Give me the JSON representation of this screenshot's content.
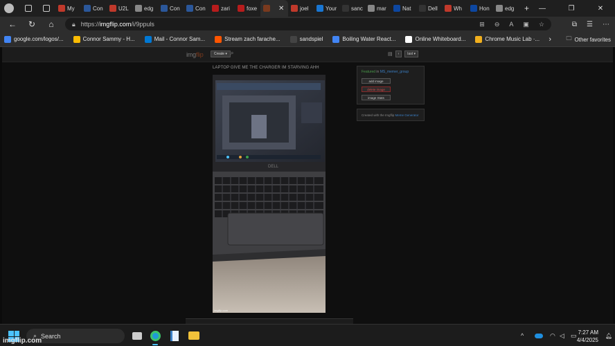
{
  "browser": {
    "tabs": [
      {
        "label": "My",
        "color": "#c0392b"
      },
      {
        "label": "Con",
        "color": "#2b579a"
      },
      {
        "label": "U2L",
        "color": "#c0392b"
      },
      {
        "label": "edg",
        "color": "#888888"
      },
      {
        "label": "Con",
        "color": "#2b579a"
      },
      {
        "label": "Con",
        "color": "#2b579a"
      },
      {
        "label": "zari",
        "color": "#b71c1c"
      },
      {
        "label": "foxe",
        "color": "#b71c1c"
      },
      {
        "label": "",
        "color": "#7a3a1e",
        "active": true
      },
      {
        "label": "joel",
        "color": "#c0392b"
      },
      {
        "label": "Your",
        "color": "#1976d2"
      },
      {
        "label": "sanc",
        "color": "#333333"
      },
      {
        "label": "mar",
        "color": "#888888"
      },
      {
        "label": "Nat",
        "color": "#0d47a1"
      },
      {
        "label": "Dell",
        "color": "#333333"
      },
      {
        "label": "Wh",
        "color": "#c0392b"
      },
      {
        "label": "Hon",
        "color": "#0d47a1"
      },
      {
        "label": "edg",
        "color": "#888888"
      }
    ],
    "close_glyph": "✕",
    "new_tab_glyph": "+",
    "url_scheme": "https://",
    "url_host": "imgflip.com",
    "url_path": "/i/9ppuls",
    "favorites": [
      {
        "label": "google.com/logos/...",
        "color": "#4285f4"
      },
      {
        "label": "Connor Sammy - H...",
        "color": "#fbbc04"
      },
      {
        "label": "Mail - Connor Sam...",
        "color": "#0078d4"
      },
      {
        "label": "Stream zach farache...",
        "color": "#ff5500"
      },
      {
        "label": "sandspiel",
        "color": "#444444"
      },
      {
        "label": "Boiling Water React...",
        "color": "#4285f4"
      },
      {
        "label": "Online Whiteboard...",
        "color": "#ffffff"
      },
      {
        "label": "Chrome Music Lab ·...",
        "color": "#f2b01e"
      }
    ],
    "other_favorites": "Other favorites"
  },
  "site": {
    "logo_img": "img",
    "logo_flip": "flip",
    "create_label": "Create ▾",
    "search_glyph": "⌕",
    "nav_prev": "‹",
    "nav_next": "last ▾"
  },
  "meme": {
    "title": "LAPTOP GIVE ME THE CHARGER IM STARVING AHH",
    "watermark": "imgflip.com"
  },
  "sidebar": {
    "featured_prefix": "Featured",
    "featured_in": " in ",
    "featured_stream": "MS_memer_group",
    "add_image": "add image",
    "delete_image": "delete image",
    "image_stats": "image Stats",
    "created_with_prefix": "Created with the Imgflip ",
    "created_with_link": "Meme Generator"
  },
  "taskbar": {
    "search_placeholder": "Search",
    "time": "7:27 AM",
    "date": "4/4/2025"
  },
  "watermark": "imgflip.com"
}
